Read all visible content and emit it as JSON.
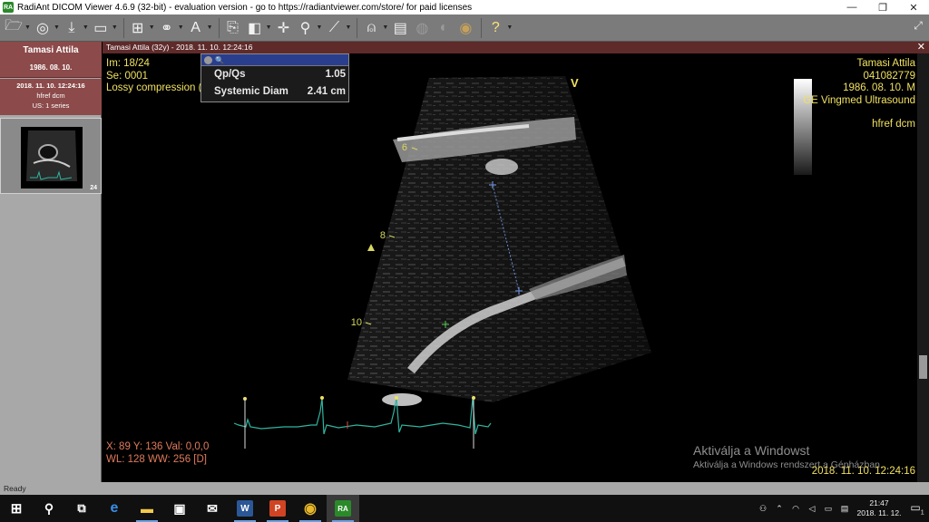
{
  "window": {
    "title": "RadiAnt DICOM Viewer 4.6.9 (32-bit) - evaluation version - go to https://radiantviewer.com/store/ for paid licenses",
    "app_icon": "RA",
    "minimize_glyph": "—",
    "restore_glyph": "❐",
    "close_glyph": "✕"
  },
  "toolbar": {
    "icons": [
      "folder-open-icon",
      "cd-icon",
      "download-icon",
      "save-icon",
      "layout-grid-icon",
      "link-icon",
      "text-annotation-icon",
      "copy-series-icon",
      "window-level-icon",
      "pan-icon",
      "zoom-icon",
      "measure-icon",
      "mpr-icon",
      "film-icon",
      "fusion-icon",
      "3d-icon",
      "radiant-logo-icon",
      "help-icon"
    ],
    "fullscreen_glyph": "⤢"
  },
  "left_panel": {
    "patient_name": "Tamasi Attila",
    "patient_dob": "1986. 08. 10.",
    "study": {
      "datetime": "2018. 11. 10. 12:24:16",
      "description": "hfref dcm",
      "series_info": "US: 1 series"
    },
    "series_thumbnail": {
      "image_count": "24"
    }
  },
  "viewer": {
    "header": "Tamasi Attila  (32y) - 2018. 11. 10. 12:24:16",
    "close_glyph": "✕",
    "top_left": {
      "image": "Im: 18/24",
      "series": "Se: 0001",
      "compression": "Lossy compression (JPEG)"
    },
    "measurements": {
      "header_icon": "🔍",
      "rows": [
        {
          "label": "Qp/Qs",
          "value": "1.05"
        },
        {
          "label": "Systemic Diam",
          "value": "2.41 cm"
        }
      ]
    },
    "top_right": {
      "name": "Tamasi Attila",
      "id": "041082779",
      "dob_sex": "1986. 08. 10. M",
      "institution": "GE Vingmed Ultrasound",
      "description": "hfref dcm"
    },
    "bottom_left": {
      "cursor": "X: 89 Y: 136 Val: 0,0,0",
      "window": "WL: 128 WW: 256 [D]"
    },
    "bottom_right": {
      "datetime": "2018. 11. 10. 12:24:16"
    },
    "ultrasound": {
      "orientation_marker": "V",
      "depth_labels": [
        "6",
        "8",
        "10"
      ]
    },
    "activation_watermark": {
      "line1": "Aktiválja a Windowst",
      "line2": "Aktiválja a Windows rendszert a Gépházban."
    },
    "colors": {
      "overlay_yellow": "#f0e060",
      "overlay_orange": "#e07a5a",
      "header_bar": "#5f2a2a",
      "study_card": "#8c4a4a",
      "ecg": "#2fb5a0"
    }
  },
  "status_bar": {
    "text": "Ready"
  },
  "taskbar": {
    "apps": [
      {
        "name": "start-icon",
        "glyph": "⊞"
      },
      {
        "name": "search-icon",
        "glyph": "⚲"
      },
      {
        "name": "task-view-icon",
        "glyph": "⧉"
      },
      {
        "name": "edge-icon",
        "glyph": "e"
      },
      {
        "name": "file-explorer-icon",
        "glyph": "▬"
      },
      {
        "name": "store-icon",
        "glyph": "▣"
      },
      {
        "name": "mail-icon",
        "glyph": "✉"
      },
      {
        "name": "word-icon",
        "glyph": "W"
      },
      {
        "name": "powerpoint-icon",
        "glyph": "P"
      },
      {
        "name": "chrome-icon",
        "glyph": "◉"
      },
      {
        "name": "radiant-icon",
        "glyph": "RA"
      }
    ],
    "tray_time": "21:47",
    "tray_date": "2018. 11. 12.",
    "notification_count": "1"
  }
}
